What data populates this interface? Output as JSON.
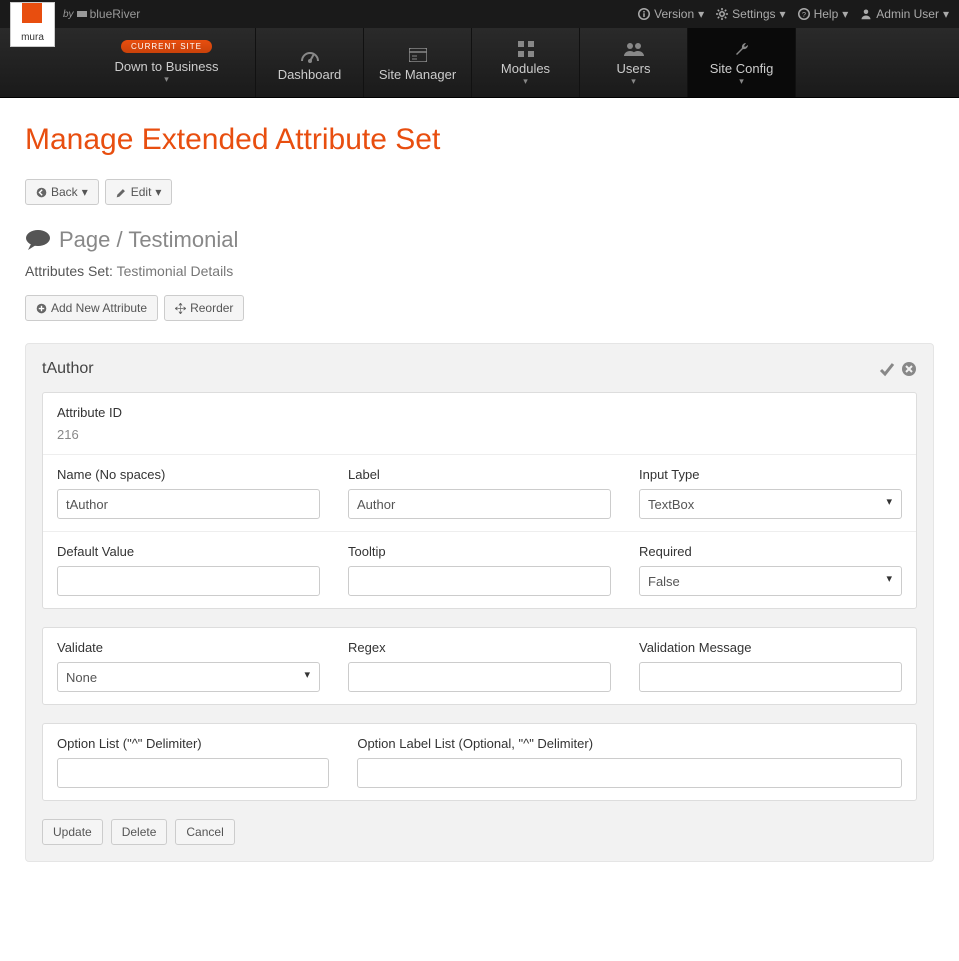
{
  "topbar": {
    "brand": "mura",
    "by": "by",
    "vendor": "blueRiver",
    "version": "Version",
    "settings": "Settings",
    "help": "Help",
    "user": "Admin User"
  },
  "nav": {
    "current_badge": "CURRENT SITE",
    "current_site": "Down to Business",
    "items": [
      {
        "label": "Dashboard"
      },
      {
        "label": "Site Manager"
      },
      {
        "label": "Modules"
      },
      {
        "label": "Users"
      },
      {
        "label": "Site Config"
      }
    ]
  },
  "page": {
    "title": "Manage Extended Attribute Set",
    "back": "Back",
    "edit": "Edit",
    "heading": "Page / Testimonial",
    "attrs_set_label": "Attributes Set:",
    "attrs_set_value": "Testimonial Details",
    "add_attr": "Add New Attribute",
    "reorder": "Reorder"
  },
  "panel": {
    "title": "tAuthor",
    "attr_id_label": "Attribute ID",
    "attr_id_value": "216",
    "name_label": "Name (No spaces)",
    "name_value": "tAuthor",
    "label_label": "Label",
    "label_value": "Author",
    "input_type_label": "Input Type",
    "input_type_value": "TextBox",
    "default_label": "Default Value",
    "default_value": "",
    "tooltip_label": "Tooltip",
    "tooltip_value": "",
    "required_label": "Required",
    "required_value": "False",
    "validate_label": "Validate",
    "validate_value": "None",
    "regex_label": "Regex",
    "regex_value": "",
    "valmsg_label": "Validation Message",
    "valmsg_value": "",
    "optlist_label": "Option List (\"^\" Delimiter)",
    "optlist_value": "",
    "optlabel_label": "Option Label List (Optional, \"^\" Delimiter)",
    "optlabel_value": ""
  },
  "actions": {
    "update": "Update",
    "delete": "Delete",
    "cancel": "Cancel"
  }
}
